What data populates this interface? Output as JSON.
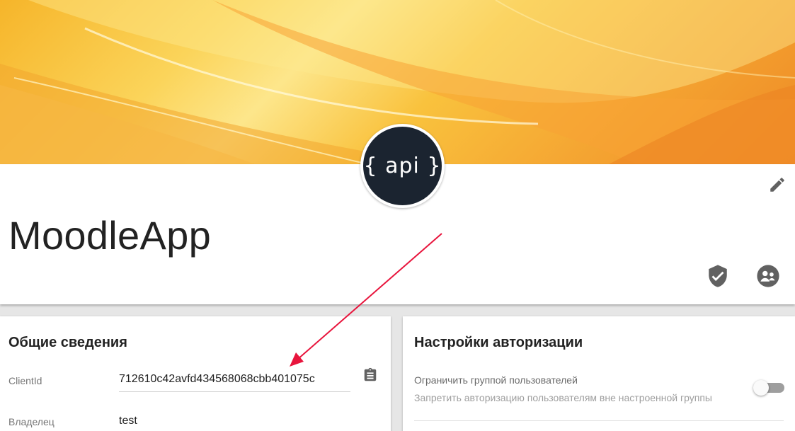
{
  "app": {
    "logo_text": "{ api }",
    "title": "MoodleApp"
  },
  "icons": {
    "edit": "pencil-icon",
    "security": "shield-check-icon",
    "groups": "group-icon",
    "copy": "clipboard-icon"
  },
  "general": {
    "title": "Общие сведения",
    "client_id_label": "ClientId",
    "client_id_value": "712610c42avfd434568068cbb401075c",
    "owner_label": "Владелец",
    "owner_value": "test"
  },
  "auth": {
    "title": "Настройки авторизации",
    "restrict_label": "Ограничить группой пользователей",
    "restrict_desc": "Запретить авторизацию пользователям вне настроенной группы",
    "restrict_enabled": false
  },
  "colors": {
    "annotation_arrow": "#e8143c",
    "logo_bg": "#1b2430"
  }
}
